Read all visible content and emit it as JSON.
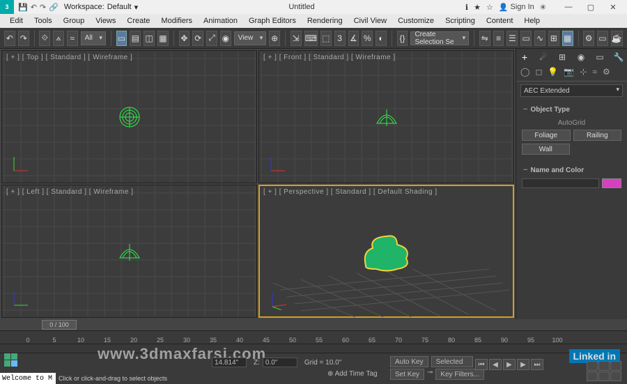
{
  "titlebar": {
    "app_icon": "3 MAX",
    "workspace_label": "Workspace:",
    "workspace_value": "Default",
    "title": "Untitled",
    "sign_in": "Sign In"
  },
  "menubar": [
    "Edit",
    "Tools",
    "Group",
    "Views",
    "Create",
    "Modifiers",
    "Animation",
    "Graph Editors",
    "Rendering",
    "Civil View",
    "Customize",
    "Scripting",
    "Content",
    "Help"
  ],
  "toolbar": {
    "filter": "All",
    "view": "View",
    "selset": "Create Selection Se"
  },
  "viewports": {
    "top": "[ + ] [ Top ] [ Standard ] [ Wireframe ]",
    "front": "[ + ] [ Front ] [ Standard ] [ Wireframe ]",
    "left": "[ + ] [ Left ] [ Standard ] [ Wireframe ]",
    "persp": "[ + ] [ Perspective ] [ Standard ] [ Default Shading ]"
  },
  "sidepanel": {
    "category": "AEC Extended",
    "object_type": "Object Type",
    "autogrid": "AutoGrid",
    "buttons": {
      "foliage": "Foliage",
      "railing": "Railing",
      "wall": "Wall"
    },
    "name_color": "Name and Color"
  },
  "timeline": {
    "marker": "0 / 100",
    "ticks": [
      0,
      5,
      10,
      15,
      20,
      25,
      30,
      35,
      40,
      45,
      50,
      55,
      60,
      65,
      70,
      75,
      80,
      85,
      90,
      95,
      100
    ]
  },
  "statusbar": {
    "welcome": "Welcome to M",
    "prompt": "Click or click-and-drag to select objects",
    "coords": {
      "x_label": "",
      "x_val": "",
      "y_label": "",
      "y_val": "14.814\"",
      "z_label": "Z:",
      "z_val": "0.0\""
    },
    "grid": "Grid = 10.0\"",
    "add_time_tag": "Add Time Tag",
    "autokey": "Auto Key",
    "selected": "Selected",
    "setkey": "Set Key",
    "keyfilters": "Key Filters...",
    "watermark": "www.3dmaxfarsi.com",
    "linkedin": "Linked in"
  }
}
